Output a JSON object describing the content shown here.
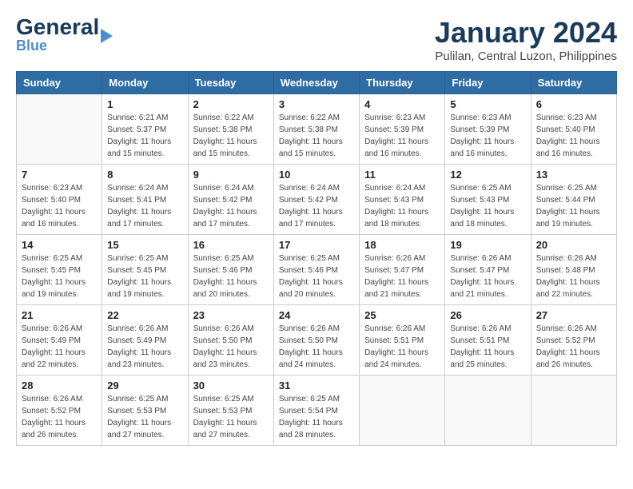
{
  "header": {
    "logo_general": "General",
    "logo_blue": "Blue",
    "month_title": "January 2024",
    "location": "Pulilan, Central Luzon, Philippines"
  },
  "calendar": {
    "days_of_week": [
      "Sunday",
      "Monday",
      "Tuesday",
      "Wednesday",
      "Thursday",
      "Friday",
      "Saturday"
    ],
    "weeks": [
      [
        {
          "day": "",
          "info": ""
        },
        {
          "day": "1",
          "info": "Sunrise: 6:21 AM\nSunset: 5:37 PM\nDaylight: 11 hours\nand 15 minutes."
        },
        {
          "day": "2",
          "info": "Sunrise: 6:22 AM\nSunset: 5:38 PM\nDaylight: 11 hours\nand 15 minutes."
        },
        {
          "day": "3",
          "info": "Sunrise: 6:22 AM\nSunset: 5:38 PM\nDaylight: 11 hours\nand 15 minutes."
        },
        {
          "day": "4",
          "info": "Sunrise: 6:23 AM\nSunset: 5:39 PM\nDaylight: 11 hours\nand 16 minutes."
        },
        {
          "day": "5",
          "info": "Sunrise: 6:23 AM\nSunset: 5:39 PM\nDaylight: 11 hours\nand 16 minutes."
        },
        {
          "day": "6",
          "info": "Sunrise: 6:23 AM\nSunset: 5:40 PM\nDaylight: 11 hours\nand 16 minutes."
        }
      ],
      [
        {
          "day": "7",
          "info": "Sunrise: 6:23 AM\nSunset: 5:40 PM\nDaylight: 11 hours\nand 16 minutes."
        },
        {
          "day": "8",
          "info": "Sunrise: 6:24 AM\nSunset: 5:41 PM\nDaylight: 11 hours\nand 17 minutes."
        },
        {
          "day": "9",
          "info": "Sunrise: 6:24 AM\nSunset: 5:42 PM\nDaylight: 11 hours\nand 17 minutes."
        },
        {
          "day": "10",
          "info": "Sunrise: 6:24 AM\nSunset: 5:42 PM\nDaylight: 11 hours\nand 17 minutes."
        },
        {
          "day": "11",
          "info": "Sunrise: 6:24 AM\nSunset: 5:43 PM\nDaylight: 11 hours\nand 18 minutes."
        },
        {
          "day": "12",
          "info": "Sunrise: 6:25 AM\nSunset: 5:43 PM\nDaylight: 11 hours\nand 18 minutes."
        },
        {
          "day": "13",
          "info": "Sunrise: 6:25 AM\nSunset: 5:44 PM\nDaylight: 11 hours\nand 19 minutes."
        }
      ],
      [
        {
          "day": "14",
          "info": "Sunrise: 6:25 AM\nSunset: 5:45 PM\nDaylight: 11 hours\nand 19 minutes."
        },
        {
          "day": "15",
          "info": "Sunrise: 6:25 AM\nSunset: 5:45 PM\nDaylight: 11 hours\nand 19 minutes."
        },
        {
          "day": "16",
          "info": "Sunrise: 6:25 AM\nSunset: 5:46 PM\nDaylight: 11 hours\nand 20 minutes."
        },
        {
          "day": "17",
          "info": "Sunrise: 6:25 AM\nSunset: 5:46 PM\nDaylight: 11 hours\nand 20 minutes."
        },
        {
          "day": "18",
          "info": "Sunrise: 6:26 AM\nSunset: 5:47 PM\nDaylight: 11 hours\nand 21 minutes."
        },
        {
          "day": "19",
          "info": "Sunrise: 6:26 AM\nSunset: 5:47 PM\nDaylight: 11 hours\nand 21 minutes."
        },
        {
          "day": "20",
          "info": "Sunrise: 6:26 AM\nSunset: 5:48 PM\nDaylight: 11 hours\nand 22 minutes."
        }
      ],
      [
        {
          "day": "21",
          "info": "Sunrise: 6:26 AM\nSunset: 5:49 PM\nDaylight: 11 hours\nand 22 minutes."
        },
        {
          "day": "22",
          "info": "Sunrise: 6:26 AM\nSunset: 5:49 PM\nDaylight: 11 hours\nand 23 minutes."
        },
        {
          "day": "23",
          "info": "Sunrise: 6:26 AM\nSunset: 5:50 PM\nDaylight: 11 hours\nand 23 minutes."
        },
        {
          "day": "24",
          "info": "Sunrise: 6:26 AM\nSunset: 5:50 PM\nDaylight: 11 hours\nand 24 minutes."
        },
        {
          "day": "25",
          "info": "Sunrise: 6:26 AM\nSunset: 5:51 PM\nDaylight: 11 hours\nand 24 minutes."
        },
        {
          "day": "26",
          "info": "Sunrise: 6:26 AM\nSunset: 5:51 PM\nDaylight: 11 hours\nand 25 minutes."
        },
        {
          "day": "27",
          "info": "Sunrise: 6:26 AM\nSunset: 5:52 PM\nDaylight: 11 hours\nand 26 minutes."
        }
      ],
      [
        {
          "day": "28",
          "info": "Sunrise: 6:26 AM\nSunset: 5:52 PM\nDaylight: 11 hours\nand 26 minutes."
        },
        {
          "day": "29",
          "info": "Sunrise: 6:25 AM\nSunset: 5:53 PM\nDaylight: 11 hours\nand 27 minutes."
        },
        {
          "day": "30",
          "info": "Sunrise: 6:25 AM\nSunset: 5:53 PM\nDaylight: 11 hours\nand 27 minutes."
        },
        {
          "day": "31",
          "info": "Sunrise: 6:25 AM\nSunset: 5:54 PM\nDaylight: 11 hours\nand 28 minutes."
        },
        {
          "day": "",
          "info": ""
        },
        {
          "day": "",
          "info": ""
        },
        {
          "day": "",
          "info": ""
        }
      ]
    ]
  }
}
